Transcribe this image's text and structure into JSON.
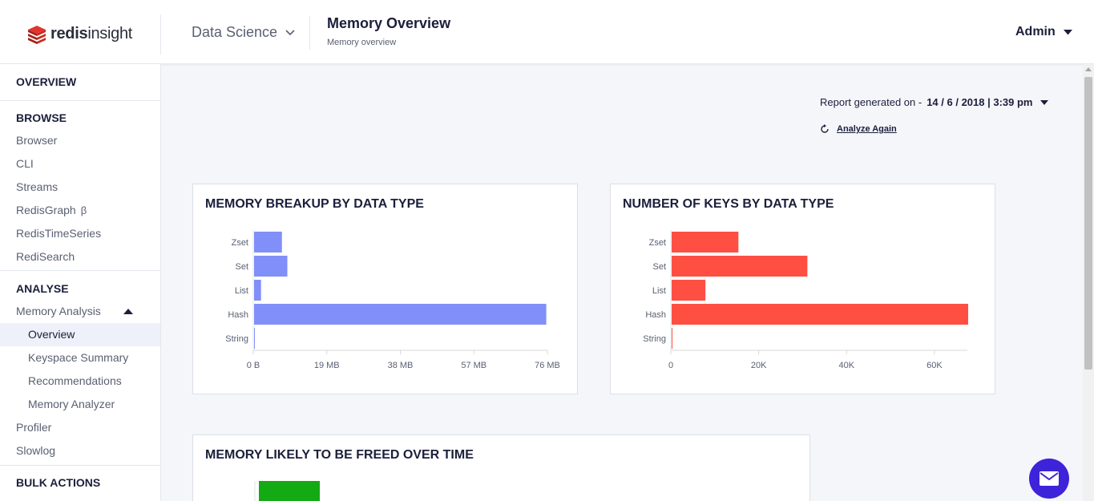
{
  "header": {
    "logo_text_bold": "redis",
    "logo_text_light": "insight",
    "database_name": "Data Science",
    "page_title": "Memory Overview",
    "page_subtitle": "Memory overview",
    "user_name": "Admin"
  },
  "sidebar": {
    "overview_label": "OVERVIEW",
    "browse_label": "BROWSE",
    "browse_items": [
      "Browser",
      "CLI",
      "Streams",
      "RedisGraph",
      "RedisTimeSeries",
      "RediSearch"
    ],
    "redisgraph_badge": "β",
    "analyse_label": "ANALYSE",
    "memory_analysis_label": "Memory Analysis",
    "memory_analysis_items": [
      "Overview",
      "Keyspace Summary",
      "Recommendations",
      "Memory Analyzer"
    ],
    "active_item": "Overview",
    "other_items": [
      "Profiler",
      "Slowlog"
    ],
    "bulk_actions_label": "BULK ACTIONS"
  },
  "report": {
    "prefix": "Report generated on -",
    "date": "14 / 6 / 2018 | 3:39 pm",
    "analyze_again_label": "Analyze Again"
  },
  "colors": {
    "memory_bar": "#8090f8",
    "keys_bar": "#ff4f42",
    "freed_bar": "#13aa13",
    "fab": "#3d23d9"
  },
  "chart_data": [
    {
      "type": "bar",
      "orientation": "horizontal",
      "title": "MEMORY BREAKUP BY DATA TYPE",
      "categories": [
        "Zset",
        "Set",
        "List",
        "Hash",
        "String"
      ],
      "values": [
        7.2,
        8.6,
        1.8,
        75.5,
        0.2
      ],
      "unit": "MB",
      "xlim": [
        0,
        76
      ],
      "xticks": [
        "0 B",
        "19 MB",
        "38 MB",
        "57 MB",
        "76 MB"
      ],
      "grid": false
    },
    {
      "type": "bar",
      "orientation": "horizontal",
      "title": "NUMBER OF KEYS BY DATA TYPE",
      "categories": [
        "Zset",
        "Set",
        "List",
        "Hash",
        "String"
      ],
      "values": [
        15200,
        30900,
        7700,
        67500,
        150
      ],
      "xlim": [
        0,
        67500
      ],
      "xticks": [
        "0",
        "20K",
        "40K",
        "60K"
      ],
      "grid": false
    },
    {
      "type": "bar",
      "orientation": "horizontal",
      "title": "MEMORY LIKELY TO BE FREED OVER TIME",
      "categories": [],
      "values": [],
      "grid": false
    }
  ],
  "fab": {
    "icon": "envelope-icon"
  }
}
